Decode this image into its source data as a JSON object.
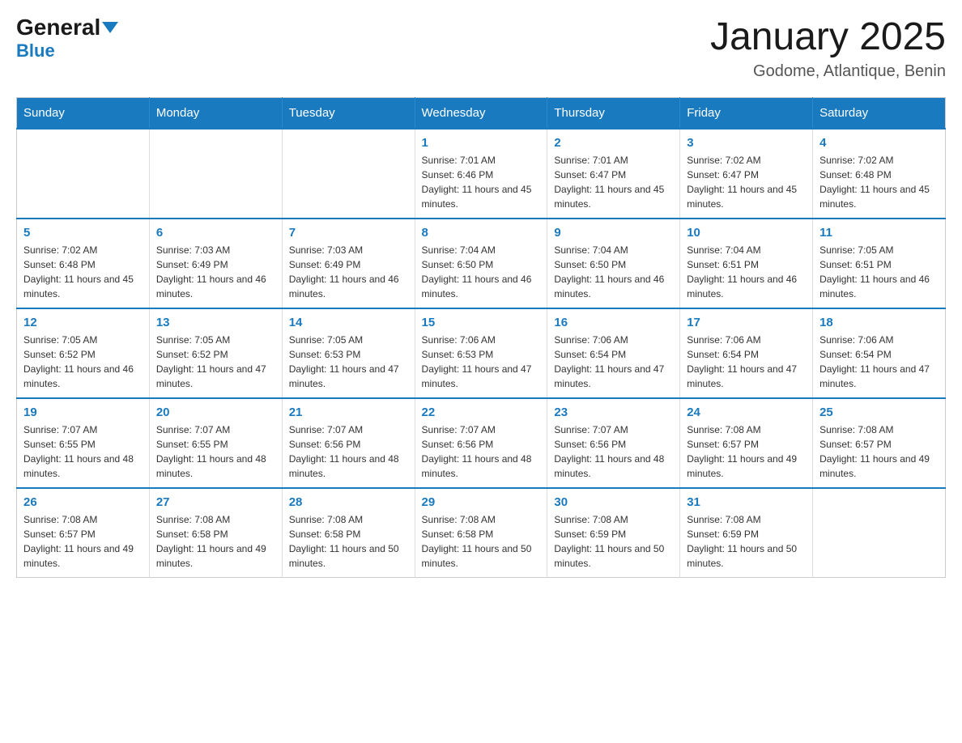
{
  "logo": {
    "general": "General",
    "blue": "Blue"
  },
  "title": "January 2025",
  "location": "Godome, Atlantique, Benin",
  "days_of_week": [
    "Sunday",
    "Monday",
    "Tuesday",
    "Wednesday",
    "Thursday",
    "Friday",
    "Saturday"
  ],
  "weeks": [
    [
      {
        "day": "",
        "info": ""
      },
      {
        "day": "",
        "info": ""
      },
      {
        "day": "",
        "info": ""
      },
      {
        "day": "1",
        "info": "Sunrise: 7:01 AM\nSunset: 6:46 PM\nDaylight: 11 hours and 45 minutes."
      },
      {
        "day": "2",
        "info": "Sunrise: 7:01 AM\nSunset: 6:47 PM\nDaylight: 11 hours and 45 minutes."
      },
      {
        "day": "3",
        "info": "Sunrise: 7:02 AM\nSunset: 6:47 PM\nDaylight: 11 hours and 45 minutes."
      },
      {
        "day": "4",
        "info": "Sunrise: 7:02 AM\nSunset: 6:48 PM\nDaylight: 11 hours and 45 minutes."
      }
    ],
    [
      {
        "day": "5",
        "info": "Sunrise: 7:02 AM\nSunset: 6:48 PM\nDaylight: 11 hours and 45 minutes."
      },
      {
        "day": "6",
        "info": "Sunrise: 7:03 AM\nSunset: 6:49 PM\nDaylight: 11 hours and 46 minutes."
      },
      {
        "day": "7",
        "info": "Sunrise: 7:03 AM\nSunset: 6:49 PM\nDaylight: 11 hours and 46 minutes."
      },
      {
        "day": "8",
        "info": "Sunrise: 7:04 AM\nSunset: 6:50 PM\nDaylight: 11 hours and 46 minutes."
      },
      {
        "day": "9",
        "info": "Sunrise: 7:04 AM\nSunset: 6:50 PM\nDaylight: 11 hours and 46 minutes."
      },
      {
        "day": "10",
        "info": "Sunrise: 7:04 AM\nSunset: 6:51 PM\nDaylight: 11 hours and 46 minutes."
      },
      {
        "day": "11",
        "info": "Sunrise: 7:05 AM\nSunset: 6:51 PM\nDaylight: 11 hours and 46 minutes."
      }
    ],
    [
      {
        "day": "12",
        "info": "Sunrise: 7:05 AM\nSunset: 6:52 PM\nDaylight: 11 hours and 46 minutes."
      },
      {
        "day": "13",
        "info": "Sunrise: 7:05 AM\nSunset: 6:52 PM\nDaylight: 11 hours and 47 minutes."
      },
      {
        "day": "14",
        "info": "Sunrise: 7:05 AM\nSunset: 6:53 PM\nDaylight: 11 hours and 47 minutes."
      },
      {
        "day": "15",
        "info": "Sunrise: 7:06 AM\nSunset: 6:53 PM\nDaylight: 11 hours and 47 minutes."
      },
      {
        "day": "16",
        "info": "Sunrise: 7:06 AM\nSunset: 6:54 PM\nDaylight: 11 hours and 47 minutes."
      },
      {
        "day": "17",
        "info": "Sunrise: 7:06 AM\nSunset: 6:54 PM\nDaylight: 11 hours and 47 minutes."
      },
      {
        "day": "18",
        "info": "Sunrise: 7:06 AM\nSunset: 6:54 PM\nDaylight: 11 hours and 47 minutes."
      }
    ],
    [
      {
        "day": "19",
        "info": "Sunrise: 7:07 AM\nSunset: 6:55 PM\nDaylight: 11 hours and 48 minutes."
      },
      {
        "day": "20",
        "info": "Sunrise: 7:07 AM\nSunset: 6:55 PM\nDaylight: 11 hours and 48 minutes."
      },
      {
        "day": "21",
        "info": "Sunrise: 7:07 AM\nSunset: 6:56 PM\nDaylight: 11 hours and 48 minutes."
      },
      {
        "day": "22",
        "info": "Sunrise: 7:07 AM\nSunset: 6:56 PM\nDaylight: 11 hours and 48 minutes."
      },
      {
        "day": "23",
        "info": "Sunrise: 7:07 AM\nSunset: 6:56 PM\nDaylight: 11 hours and 48 minutes."
      },
      {
        "day": "24",
        "info": "Sunrise: 7:08 AM\nSunset: 6:57 PM\nDaylight: 11 hours and 49 minutes."
      },
      {
        "day": "25",
        "info": "Sunrise: 7:08 AM\nSunset: 6:57 PM\nDaylight: 11 hours and 49 minutes."
      }
    ],
    [
      {
        "day": "26",
        "info": "Sunrise: 7:08 AM\nSunset: 6:57 PM\nDaylight: 11 hours and 49 minutes."
      },
      {
        "day": "27",
        "info": "Sunrise: 7:08 AM\nSunset: 6:58 PM\nDaylight: 11 hours and 49 minutes."
      },
      {
        "day": "28",
        "info": "Sunrise: 7:08 AM\nSunset: 6:58 PM\nDaylight: 11 hours and 50 minutes."
      },
      {
        "day": "29",
        "info": "Sunrise: 7:08 AM\nSunset: 6:58 PM\nDaylight: 11 hours and 50 minutes."
      },
      {
        "day": "30",
        "info": "Sunrise: 7:08 AM\nSunset: 6:59 PM\nDaylight: 11 hours and 50 minutes."
      },
      {
        "day": "31",
        "info": "Sunrise: 7:08 AM\nSunset: 6:59 PM\nDaylight: 11 hours and 50 minutes."
      },
      {
        "day": "",
        "info": ""
      }
    ]
  ]
}
